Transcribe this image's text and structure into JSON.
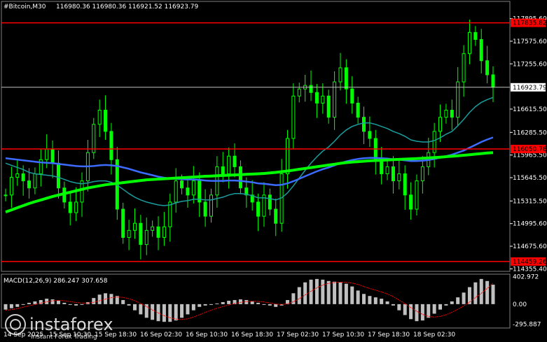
{
  "header": {
    "symbol": "#Bitcoin,M30",
    "ohlc": "116980.36 116980.36 116921.52 116923.79"
  },
  "colors": {
    "background": "#000000",
    "candle": "#00ff00",
    "ma_fast": "#1a9e9e",
    "ma_mid": "#3b6cff",
    "ma_slow": "#00ff00",
    "level": "#ff0000",
    "level_label_bg": "#ff0000",
    "level_label_text": "#000000",
    "price_label_bg": "#ffffff",
    "macd_hist": "#c0c0c0",
    "macd_signal": "#ff0000"
  },
  "chart_data": [
    {
      "type": "candlestick",
      "title": "#Bitcoin,M30",
      "y_ticks": [
        "117895.60",
        "117575.60",
        "117255.60",
        "116615.50",
        "116285.50",
        "115965.50",
        "115645.50",
        "115315.50",
        "114995.60",
        "114675.60",
        "114355.40"
      ],
      "ylim": [
        114320,
        118020
      ],
      "x_ticks": [
        "14 Sep 2025",
        "15 Sep 10:30",
        "15 Sep 18:30",
        "16 Sep 02:30",
        "16 Sep 10:30",
        "16 Sep 18:30",
        "17 Sep 02:30",
        "17 Sep 10:30",
        "17 Sep 18:30",
        "18 Sep 02:30"
      ],
      "current_price": "116923.79",
      "levels": [
        {
          "value": 117835.82,
          "label": "117835.82"
        },
        {
          "value": 116050.78,
          "label": "116050.78"
        },
        {
          "value": 114459.26,
          "label": "114459.26"
        }
      ],
      "close": [
        115400,
        115650,
        115700,
        115600,
        115500,
        115700,
        115900,
        116050,
        115850,
        115500,
        115300,
        115150,
        115300,
        115600,
        116000,
        116400,
        116600,
        116300,
        115900,
        115200,
        114800,
        114900,
        115000,
        114700,
        114900,
        114950,
        114800,
        114950,
        115300,
        115600,
        115500,
        115400,
        115600,
        115300,
        115100,
        115400,
        115800,
        115700,
        115950,
        115800,
        115500,
        115400,
        115300,
        115100,
        115400,
        115200,
        115000,
        115700,
        116200,
        116800,
        116900,
        116950,
        116850,
        116700,
        116800,
        116500,
        117000,
        117200,
        116900,
        116700,
        116500,
        116300,
        116200,
        115900,
        115700,
        115800,
        115600,
        115700,
        115400,
        115200,
        115600,
        115800,
        116000,
        116300,
        116500,
        116600,
        116500,
        117000,
        117400,
        117700,
        117600,
        117300,
        117100,
        116924
      ],
      "series": [
        {
          "name": "MA fast",
          "values": [
            115850,
            115820,
            115790,
            115760,
            115720,
            115700,
            115690,
            115680,
            115670,
            115650,
            115620,
            115590,
            115570,
            115560,
            115570,
            115590,
            115600,
            115600,
            115580,
            115540,
            115480,
            115420,
            115370,
            115330,
            115300,
            115280,
            115260,
            115250,
            115260,
            115290,
            115310,
            115320,
            115340,
            115340,
            115330,
            115330,
            115350,
            115370,
            115400,
            115420,
            115420,
            115410,
            115390,
            115360,
            115360,
            115350,
            115330,
            115360,
            115430,
            115530,
            115640,
            115750,
            115850,
            115940,
            116020,
            116080,
            116160,
            116250,
            116320,
            116370,
            116400,
            116420,
            116420,
            116400,
            116370,
            116340,
            116300,
            116270,
            116230,
            116180,
            116160,
            116150,
            116150,
            116170,
            116210,
            116260,
            116300,
            116380,
            116470,
            116570,
            116650,
            116710,
            116750,
            116780
          ]
        },
        {
          "name": "MA mid",
          "values": [
            115920,
            115910,
            115900,
            115890,
            115880,
            115870,
            115860,
            115855,
            115850,
            115840,
            115830,
            115820,
            115810,
            115805,
            115805,
            115810,
            115820,
            115825,
            115820,
            115810,
            115790,
            115770,
            115745,
            115720,
            115700,
            115680,
            115660,
            115645,
            115635,
            115630,
            115625,
            115620,
            115620,
            115615,
            115605,
            115600,
            115600,
            115600,
            115605,
            115605,
            115600,
            115590,
            115580,
            115565,
            115560,
            115550,
            115540,
            115545,
            115565,
            115595,
            115630,
            115665,
            115700,
            115735,
            115765,
            115790,
            115820,
            115850,
            115875,
            115895,
            115910,
            115920,
            115925,
            115925,
            115920,
            115915,
            115905,
            115900,
            115890,
            115880,
            115880,
            115885,
            115895,
            115910,
            115930,
            115950,
            115970,
            116000,
            116030,
            116070,
            116110,
            116150,
            116185,
            116215
          ]
        },
        {
          "name": "MA slow",
          "values": [
            115160,
            115190,
            115220,
            115250,
            115280,
            115305,
            115330,
            115355,
            115380,
            115400,
            115420,
            115440,
            115460,
            115480,
            115500,
            115515,
            115530,
            115545,
            115555,
            115565,
            115575,
            115585,
            115595,
            115605,
            115615,
            115620,
            115625,
            115630,
            115635,
            115640,
            115645,
            115650,
            115655,
            115660,
            115665,
            115668,
            115672,
            115676,
            115680,
            115684,
            115688,
            115692,
            115696,
            115700,
            115705,
            115712,
            115720,
            115730,
            115740,
            115752,
            115764,
            115776,
            115788,
            115800,
            115812,
            115824,
            115836,
            115848,
            115858,
            115866,
            115872,
            115878,
            115884,
            115888,
            115892,
            115896,
            115900,
            115904,
            115908,
            115912,
            115916,
            115920,
            115925,
            115930,
            115936,
            115942,
            115948,
            115955,
            115962,
            115970,
            115978,
            115986,
            115994,
            116000
          ]
        }
      ]
    },
    {
      "type": "bar",
      "title": "MACD(12,26,9) 286.247 307.658",
      "y_ticks": [
        "402.972",
        "0.00",
        "-295.887"
      ],
      "ylim": [
        -330,
        420
      ],
      "histogram": [
        -80,
        -60,
        -40,
        -10,
        20,
        40,
        60,
        80,
        70,
        50,
        20,
        -10,
        -20,
        -10,
        30,
        90,
        140,
        160,
        150,
        120,
        60,
        -20,
        -90,
        -150,
        -200,
        -230,
        -250,
        -260,
        -260,
        -240,
        -200,
        -150,
        -90,
        -40,
        -20,
        -10,
        10,
        30,
        50,
        60,
        70,
        60,
        40,
        20,
        0,
        -20,
        -40,
        -20,
        60,
        160,
        250,
        320,
        360,
        370,
        360,
        340,
        330,
        320,
        300,
        260,
        200,
        150,
        120,
        100,
        80,
        40,
        -20,
        -90,
        -160,
        -220,
        -250,
        -240,
        -200,
        -140,
        -80,
        -20,
        40,
        100,
        170,
        250,
        320,
        370,
        340,
        286
      ],
      "signal": [
        -90,
        -80,
        -65,
        -45,
        -25,
        -5,
        15,
        35,
        50,
        55,
        50,
        38,
        25,
        15,
        15,
        28,
        50,
        75,
        95,
        105,
        100,
        80,
        50,
        10,
        -35,
        -85,
        -130,
        -170,
        -200,
        -220,
        -225,
        -215,
        -190,
        -155,
        -120,
        -90,
        -60,
        -35,
        -12,
        10,
        25,
        38,
        43,
        40,
        32,
        18,
        2,
        -5,
        5,
        35,
        80,
        135,
        190,
        240,
        280,
        305,
        318,
        322,
        320,
        310,
        290,
        260,
        230,
        205,
        180,
        150,
        110,
        60,
        5,
        -50,
        -105,
        -150,
        -180,
        -190,
        -180,
        -155,
        -120,
        -75,
        -25,
        30,
        95,
        160,
        230,
        308
      ],
      "series": [
        {
          "name": "MACD",
          "values": []
        },
        {
          "name": "Signal",
          "values": []
        }
      ]
    }
  ],
  "watermark": {
    "brand": "instaforex",
    "tagline": "Instant Forex Trading"
  }
}
